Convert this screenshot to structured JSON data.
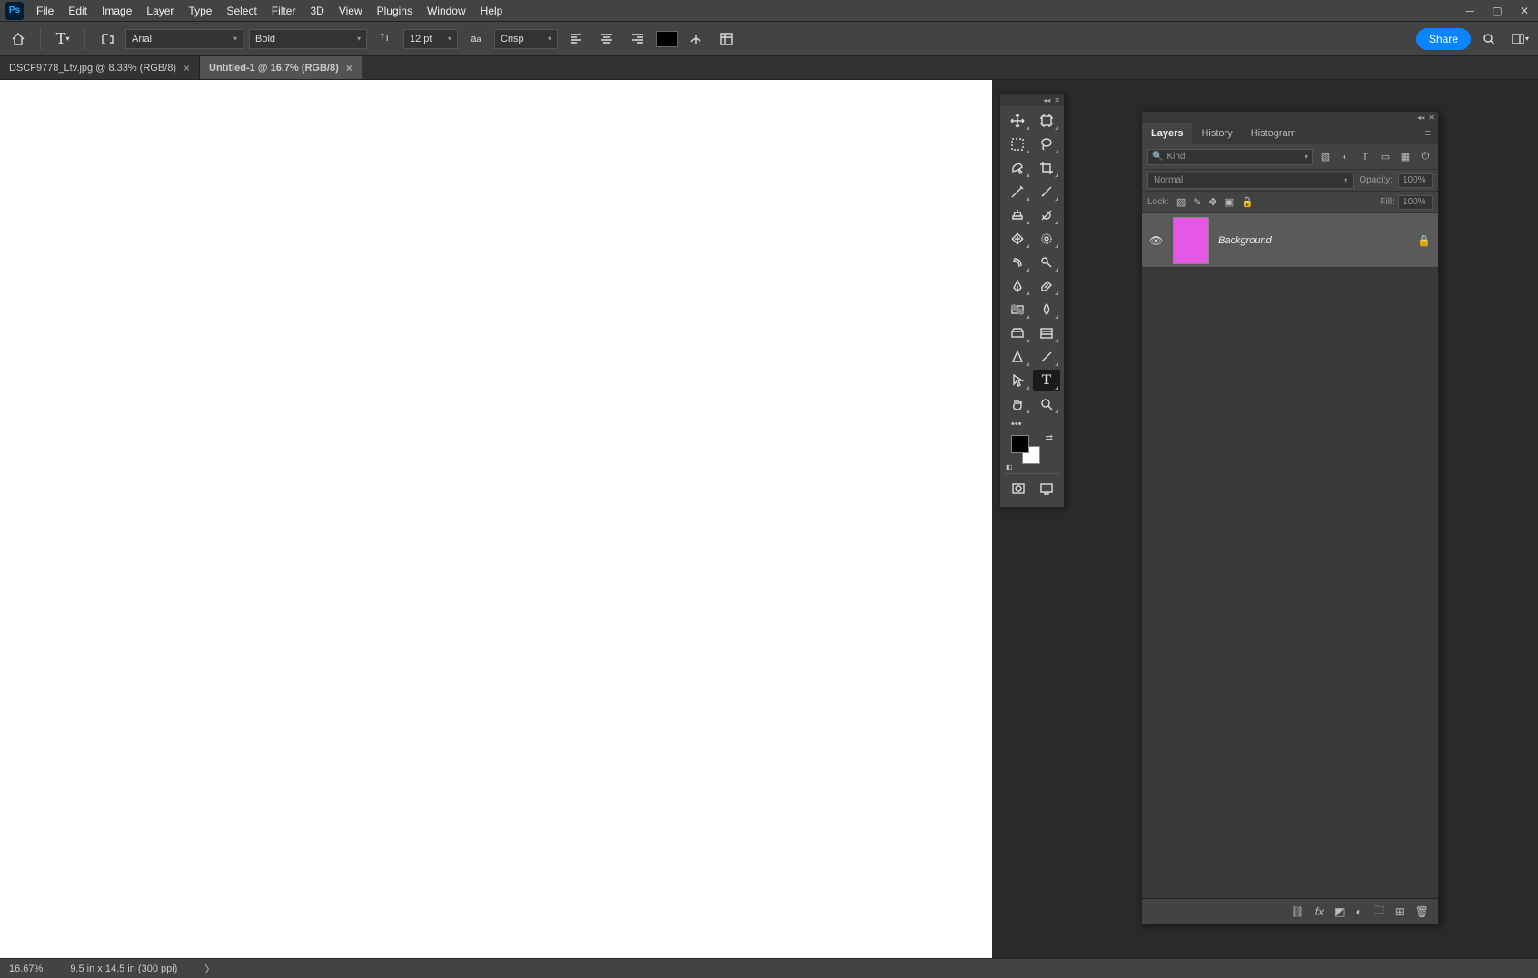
{
  "app_icon": "Ps",
  "menu": [
    "File",
    "Edit",
    "Image",
    "Layer",
    "Type",
    "Select",
    "Filter",
    "3D",
    "View",
    "Plugins",
    "Window",
    "Help"
  ],
  "options": {
    "font_family": "Arial",
    "font_style": "Bold",
    "font_size": "12 pt",
    "aa": "Crisp",
    "share": "Share",
    "opacity_label": "Opacity:",
    "fill_label": "Fill:"
  },
  "tabs": [
    {
      "label": "DSCF9778_Ltv.jpg @ 8.33% (RGB/8)",
      "active": false
    },
    {
      "label": "Untitled-1 @ 16.7% (RGB/8)",
      "active": true
    }
  ],
  "layers_panel": {
    "tabs": [
      "Layers",
      "History",
      "Histogram"
    ],
    "kind_placeholder": "Kind",
    "blend_mode": "Normal",
    "opacity": "100%",
    "fill": "100%",
    "lock_label": "Lock:",
    "layer": {
      "name": "Background",
      "thumb_color": "#e558e5"
    }
  },
  "status": {
    "zoom": "16.67%",
    "dims": "9.5 in x 14.5 in (300 ppi)"
  }
}
